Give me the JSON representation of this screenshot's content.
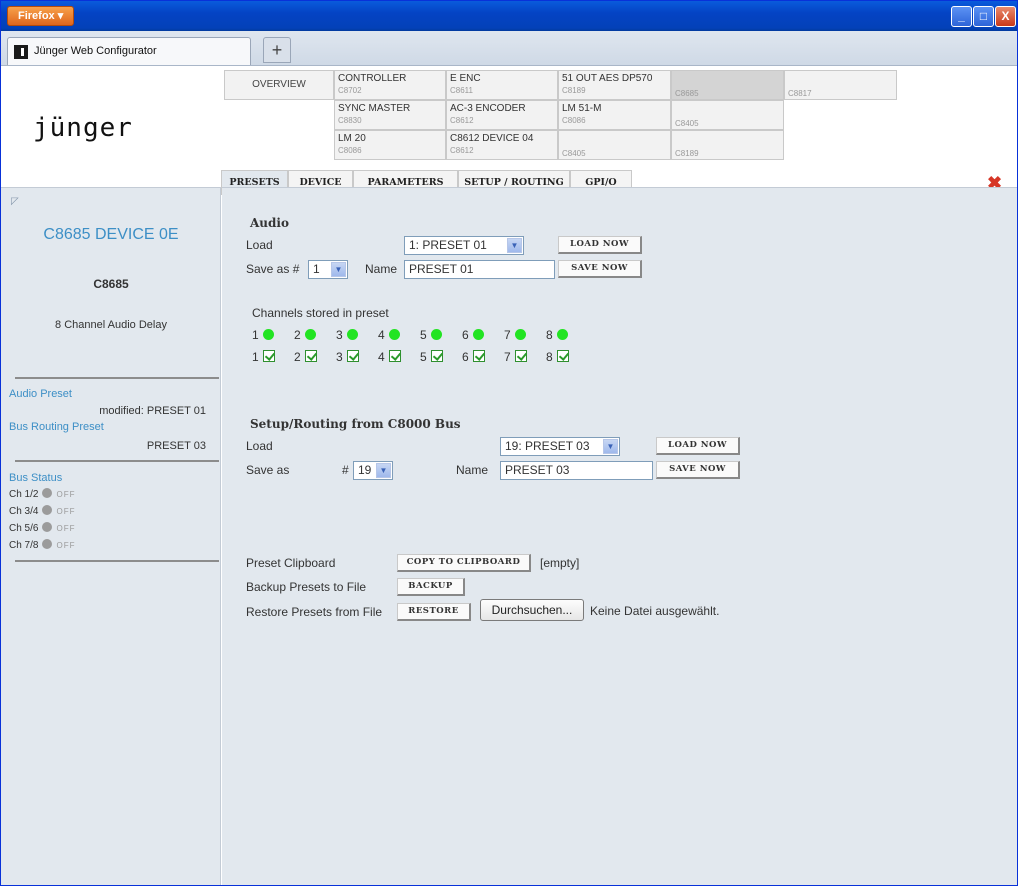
{
  "browser": {
    "menu_label": "Firefox",
    "tab_title": "Jünger Web Configurator",
    "new_tab_symbol": "+",
    "window_buttons": [
      "_",
      "□",
      "X"
    ]
  },
  "header": {
    "logo_text": "jünger",
    "overview_label": "OVERVIEW",
    "devices": [
      {
        "name": "CONTROLLER",
        "code": "C8702"
      },
      {
        "name": "E ENC",
        "code": "C8611"
      },
      {
        "name": "51 OUT AES DP570",
        "code": "C8189"
      },
      {
        "name": "",
        "code": "C8685"
      },
      {
        "name": "",
        "code": "C8817"
      },
      {
        "name": "SYNC MASTER",
        "code": "C8830"
      },
      {
        "name": "AC-3 ENCODER",
        "code": "C8612"
      },
      {
        "name": "LM 51-M",
        "code": "C8086"
      },
      {
        "name": "",
        "code": "C8405"
      },
      {
        "name": "LM 20",
        "code": "C8086"
      },
      {
        "name": "C8612 DEVICE 04",
        "code": "C8612"
      },
      {
        "name": "",
        "code": "C8405"
      },
      {
        "name": "",
        "code": "C8189"
      }
    ]
  },
  "tabs": [
    "PRESETS",
    "DEVICE",
    "PARAMETERS",
    "SETUP / ROUTING",
    "GPI/O"
  ],
  "active_tab": "PRESETS",
  "sidebar": {
    "device_title": "C8685 DEVICE 0E",
    "device_code": "C8685",
    "device_desc": "8 Channel Audio Delay",
    "audio_preset_label": "Audio Preset",
    "audio_preset_value": "modified: PRESET 01",
    "bus_routing_label": "Bus Routing Preset",
    "bus_routing_value": "PRESET 03",
    "bus_status_label": "Bus Status",
    "bus_rows": [
      {
        "ch": "Ch 1/2",
        "state": "OFF"
      },
      {
        "ch": "Ch 3/4",
        "state": "OFF"
      },
      {
        "ch": "Ch 5/6",
        "state": "OFF"
      },
      {
        "ch": "Ch 7/8",
        "state": "OFF"
      }
    ]
  },
  "audio": {
    "heading": "Audio",
    "load_label": "Load",
    "load_select": "1: PRESET 01",
    "load_button": "LOAD NOW",
    "save_label": "Save as #",
    "save_number": "1",
    "name_label": "Name",
    "name_value": "PRESET 01",
    "save_button": "SAVE NOW",
    "channels_label": "Channels stored in preset",
    "channels": [
      "1",
      "2",
      "3",
      "4",
      "5",
      "6",
      "7",
      "8"
    ]
  },
  "routing": {
    "heading": "Setup/Routing from C8000 Bus",
    "load_label": "Load",
    "load_select": "19: PRESET 03",
    "load_button": "LOAD NOW",
    "save_label": "Save as",
    "hash": "#",
    "save_number": "19",
    "name_label": "Name",
    "name_value": "PRESET 03",
    "save_button": "SAVE NOW"
  },
  "clipboard": {
    "clipboard_label": "Preset Clipboard",
    "copy_button": "COPY TO CLIPBOARD",
    "clipboard_status": "[empty]",
    "backup_label": "Backup Presets to File",
    "backup_button": "BACKUP",
    "restore_label": "Restore Presets from File",
    "restore_button": "RESTORE",
    "browse_button": "Durchsuchen...",
    "file_status": "Keine Datei ausgewählt."
  },
  "colors": {
    "accent_blue": "#3d8fc6",
    "panel_bg": "#e2e8ee",
    "channel_green": "#22e422",
    "close_red": "#d63626"
  }
}
